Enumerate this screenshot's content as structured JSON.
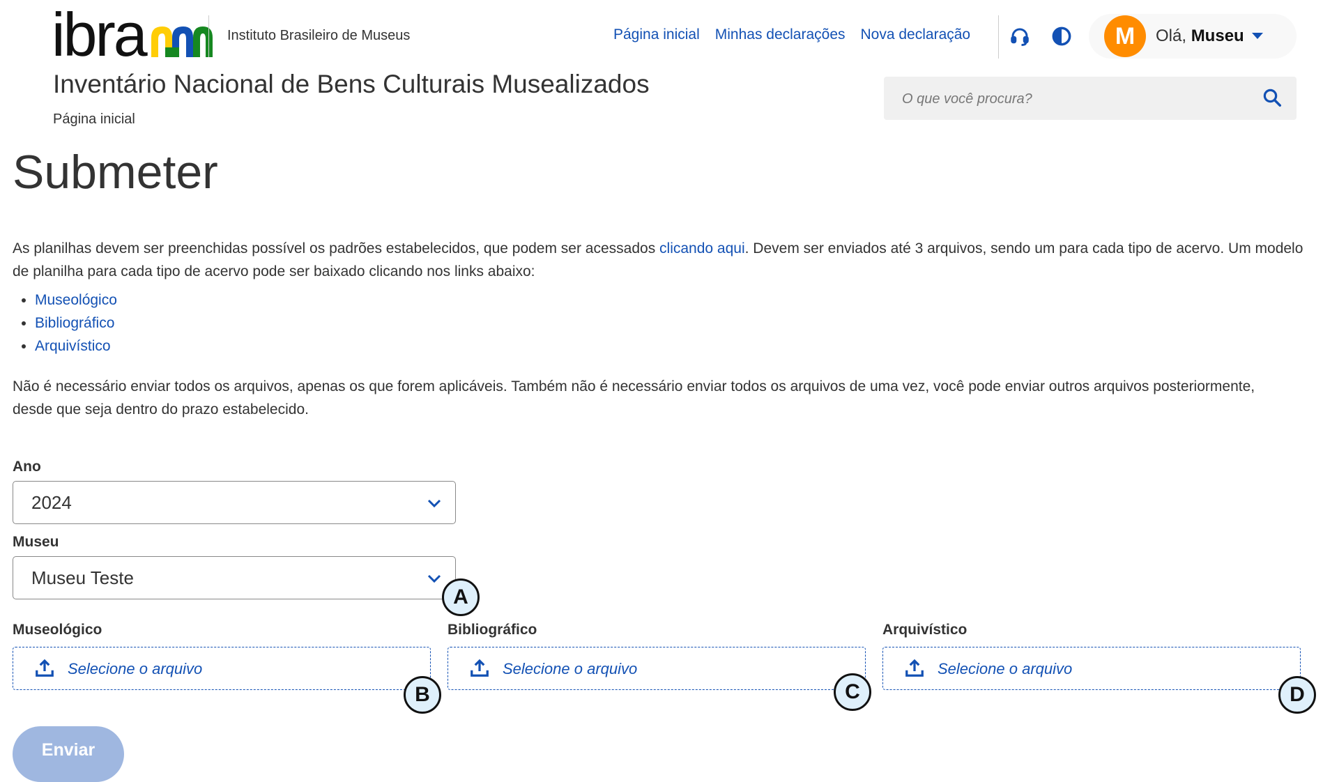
{
  "header": {
    "logo_text": "ibram",
    "institution": "Instituto Brasileiro de Museus",
    "nav": [
      "Página inicial",
      "Minhas declarações",
      "Nova declaração"
    ],
    "icons": [
      "headset-icon",
      "contrast-icon"
    ],
    "user": {
      "avatar_letter": "M",
      "greeting": "Olá,",
      "name": "Museu"
    },
    "site_title": "Inventário Nacional de Bens Culturais Musealizados",
    "breadcrumb": "Página inicial",
    "search": {
      "placeholder": "O que você procura?"
    }
  },
  "main": {
    "title": "Submeter",
    "intro": {
      "before_link": "As planilhas devem ser preenchidas possível os padrões estabelecidos, que podem ser acessados ",
      "link": "clicando aqui",
      "after_link": ". Devem ser enviados até 3 arquivos, sendo um para cada tipo de acervo. Um modelo de planilha para cada tipo de acervo pode ser baixado clicando nos links abaixo:"
    },
    "downloads": [
      "Museológico",
      "Bibliográfico",
      "Arquivístico"
    ],
    "note": "Não é necessário enviar todos os arquivos, apenas os que forem aplicáveis. Também não é necessário enviar todos os arquivos de uma vez, você pode enviar outros arquivos posteriormente, desde que seja dentro do prazo estabelecido.",
    "form": {
      "ano": {
        "label": "Ano",
        "value": "2024"
      },
      "museu": {
        "label": "Museu",
        "value": "Museu Teste"
      },
      "uploads": [
        {
          "label": "Museológico",
          "placeholder": "Selecione o arquivo"
        },
        {
          "label": "Bibliográfico",
          "placeholder": "Selecione o arquivo"
        },
        {
          "label": "Arquivístico",
          "placeholder": "Selecione o arquivo"
        }
      ],
      "submit": "Enviar"
    },
    "badges": [
      "A",
      "B",
      "C",
      "D"
    ]
  },
  "colors": {
    "link": "#1351b4",
    "avatar": "#ff8c00",
    "submit_disabled": "#9fb7e0",
    "badge_fill": "#dff0fb"
  }
}
